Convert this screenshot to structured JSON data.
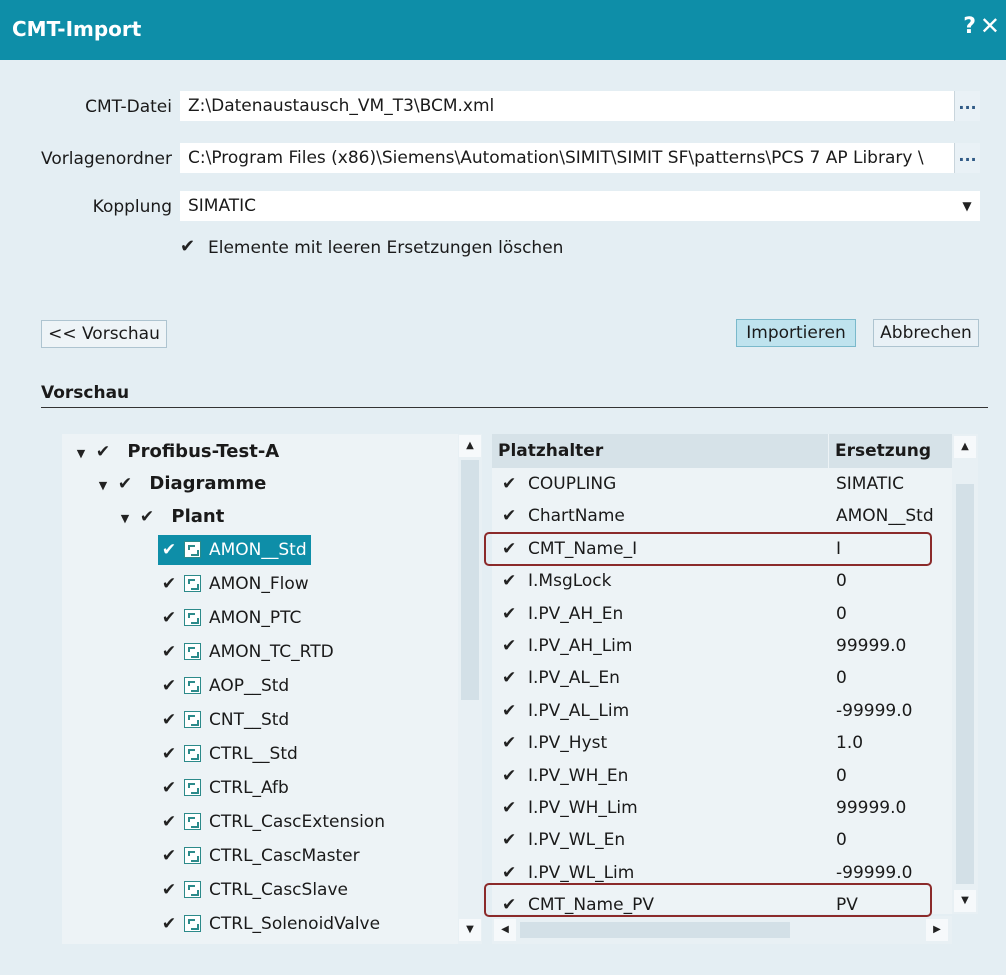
{
  "window": {
    "title": "CMT-Import",
    "help": "?",
    "close": "✕"
  },
  "form": {
    "cmt_file_label": "CMT-Datei",
    "cmt_file_value": "Z:\\Datenaustausch_VM_T3\\BCM.xml",
    "template_label": "Vorlagenordner",
    "template_value": "C:\\Program Files (x86)\\Siemens\\Automation\\SIMIT\\SIMIT SF\\patterns\\PCS 7 AP Library \\",
    "coupling_label": "Kopplung",
    "coupling_value": "SIMATIC",
    "browse": "...",
    "delete_empty_label": "Elemente mit leeren Ersetzungen löschen",
    "delete_empty_checked": true
  },
  "buttons": {
    "preview": "<< Vorschau",
    "import": "Importieren",
    "cancel": "Abbrechen"
  },
  "preview": {
    "heading": "Vorschau",
    "tree": {
      "root": "Profibus-Test-A",
      "folder": "Diagramme",
      "plant": "Plant",
      "charts": [
        "AMON__Std",
        "AMON_Flow",
        "AMON_PTC",
        "AMON_TC_RTD",
        "AOP__Std",
        "CNT__Std",
        "CTRL__Std",
        "CTRL_Afb",
        "CTRL_CascExtension",
        "CTRL_CascMaster",
        "CTRL_CascSlave",
        "CTRL_SolenoidValve"
      ],
      "selected": "AMON__Std"
    },
    "grid": {
      "col_placeholder": "Platzhalter",
      "col_replacement": "Ersetzung",
      "rows": [
        {
          "name": "COUPLING",
          "value": "SIMATIC"
        },
        {
          "name": "ChartName",
          "value": "AMON__Std"
        },
        {
          "name": "CMT_Name_I",
          "value": "I",
          "highlighted": true
        },
        {
          "name": "I.MsgLock",
          "value": "0"
        },
        {
          "name": "I.PV_AH_En",
          "value": "0"
        },
        {
          "name": "I.PV_AH_Lim",
          "value": "99999.0"
        },
        {
          "name": "I.PV_AL_En",
          "value": "0"
        },
        {
          "name": "I.PV_AL_Lim",
          "value": "-99999.0"
        },
        {
          "name": "I.PV_Hyst",
          "value": "1.0"
        },
        {
          "name": "I.PV_WH_En",
          "value": "0"
        },
        {
          "name": "I.PV_WH_Lim",
          "value": "99999.0"
        },
        {
          "name": "I.PV_WL_En",
          "value": "0"
        },
        {
          "name": "I.PV_WL_Lim",
          "value": "-99999.0"
        },
        {
          "name": "CMT_Name_PV",
          "value": "PV",
          "highlighted": true
        }
      ]
    }
  },
  "colors": {
    "titlebar": "#0e8ea8",
    "background": "#e4eef3",
    "selection": "#0e8ea8",
    "highlight_border": "#8b2a2a"
  },
  "icons": {
    "check": "check-icon",
    "expand": "triangle-down-icon",
    "chart": "cfc-chart-icon",
    "scroll_up": "arrow-up-icon",
    "scroll_down": "arrow-down-icon"
  }
}
